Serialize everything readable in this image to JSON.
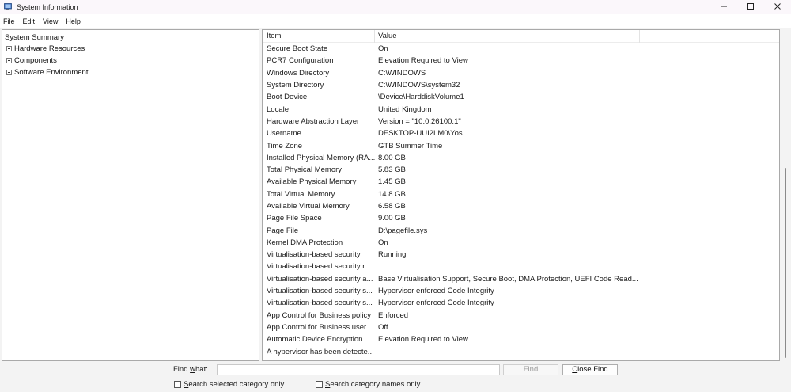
{
  "window": {
    "title": "System Information",
    "icon": "system-information-icon",
    "controls": {
      "minimize": "—",
      "maximize": "☐",
      "close": "✕"
    }
  },
  "menu": [
    "File",
    "Edit",
    "View",
    "Help"
  ],
  "tree": {
    "root": "System Summary",
    "children": [
      "Hardware Resources",
      "Components",
      "Software Environment"
    ]
  },
  "list": {
    "headers": {
      "item": "Item",
      "value": "Value"
    },
    "rows": [
      {
        "item": "Secure Boot State",
        "value": "On"
      },
      {
        "item": "PCR7 Configuration",
        "value": "Elevation Required to View"
      },
      {
        "item": "Windows Directory",
        "value": "C:\\WINDOWS"
      },
      {
        "item": "System Directory",
        "value": "C:\\WINDOWS\\system32"
      },
      {
        "item": "Boot Device",
        "value": "\\Device\\HarddiskVolume1"
      },
      {
        "item": "Locale",
        "value": "United Kingdom"
      },
      {
        "item": "Hardware Abstraction Layer",
        "value": "Version = \"10.0.26100.1\""
      },
      {
        "item": "Username",
        "value": "DESKTOP-UUI2LM0\\Yos"
      },
      {
        "item": "Time Zone",
        "value": "GTB Summer Time"
      },
      {
        "item": "Installed Physical Memory (RA...",
        "value": "8.00 GB"
      },
      {
        "item": "Total Physical Memory",
        "value": "5.83 GB"
      },
      {
        "item": "Available Physical Memory",
        "value": "1.45 GB"
      },
      {
        "item": "Total Virtual Memory",
        "value": "14.8 GB"
      },
      {
        "item": "Available Virtual Memory",
        "value": "6.58 GB"
      },
      {
        "item": "Page File Space",
        "value": "9.00 GB"
      },
      {
        "item": "Page File",
        "value": "D:\\pagefile.sys"
      },
      {
        "item": "Kernel DMA Protection",
        "value": "On"
      },
      {
        "item": "Virtualisation-based security",
        "value": "Running"
      },
      {
        "item": "Virtualisation-based security r...",
        "value": ""
      },
      {
        "item": "Virtualisation-based security a...",
        "value": "Base Virtualisation Support, Secure Boot, DMA Protection, UEFI Code Read..."
      },
      {
        "item": "Virtualisation-based security s...",
        "value": "Hypervisor enforced Code Integrity"
      },
      {
        "item": "Virtualisation-based security s...",
        "value": "Hypervisor enforced Code Integrity"
      },
      {
        "item": "App Control for Business policy",
        "value": "Enforced"
      },
      {
        "item": "App Control for Business user ...",
        "value": "Off"
      },
      {
        "item": "Automatic Device Encryption ...",
        "value": "Elevation Required to View"
      },
      {
        "item": "A hypervisor has been detecte...",
        "value": ""
      }
    ]
  },
  "find": {
    "label_prefix": "Find ",
    "label_underlined": "w",
    "label_suffix": "hat:",
    "input_value": "",
    "find_button": "Find",
    "close_button_underlined": "C",
    "close_button_rest": "lose Find",
    "check1_underlined": "S",
    "check1_rest": "earch selected category only",
    "check2_underlined": "S",
    "check2_rest": "earch category names only"
  },
  "colors": {
    "titlebar": "#fbf7fb",
    "panel_border": "#a9a9a9",
    "disabled_text": "#9a9a9a"
  }
}
